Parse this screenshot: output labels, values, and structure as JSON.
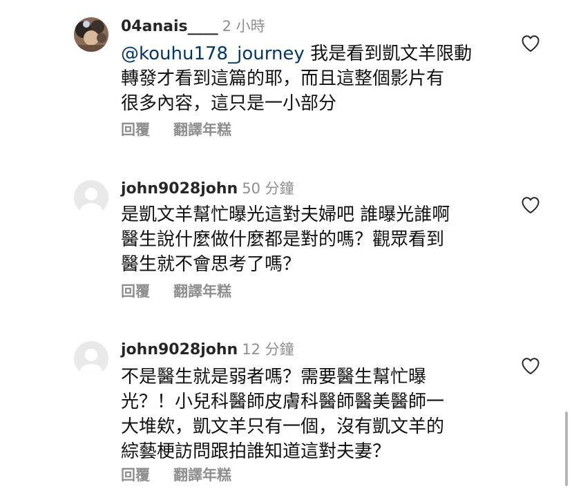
{
  "comments": [
    {
      "username": "04anais____",
      "time": "2 小時",
      "mention": "@kouhu178_journey",
      "lines": [
        "我是看到凱文羊限動",
        "轉發才看到這篇的耶，而且這整個影片有",
        "很多內容，這只是一小部分"
      ],
      "reply_label": "回覆",
      "translate_label": "翻譯年糕",
      "avatar": "photo-avatar",
      "like_icon": "heart-outline-icon"
    },
    {
      "username": "john9028john",
      "time": "50 分鐘",
      "lines": [
        "是凱文羊幫忙曝光這對夫婦吧 誰曝光誰啊",
        "醫生說什麼做什麼都是對的嗎？觀眾看到",
        "醫生就不會思考了嗎？"
      ],
      "reply_label": "回覆",
      "translate_label": "翻譯年糕",
      "avatar": "default-avatar",
      "like_icon": "heart-outline-icon"
    },
    {
      "username": "john9028john",
      "time": "12 分鐘",
      "lines": [
        "不是醫生就是弱者嗎？需要醫生幫忙曝",
        "光？！小兒科醫師皮膚科醫師醫美醫師一",
        "大堆欸，凱文羊只有一個，沒有凱文羊的",
        "綜藝梗訪問跟拍誰知道這對夫妻？"
      ],
      "reply_label": "回覆",
      "translate_label": "翻譯年糕",
      "avatar": "default-avatar",
      "like_icon": "heart-outline-icon"
    }
  ],
  "colors": {
    "username": "#262626",
    "secondary_text": "#8e8e8e",
    "mention": "#00376b",
    "body_text": "#111111"
  }
}
